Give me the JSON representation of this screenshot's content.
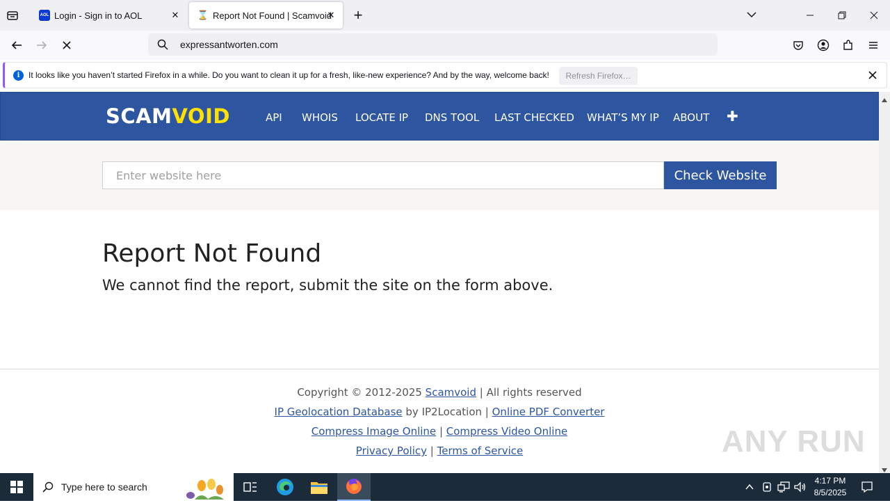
{
  "browser": {
    "tabs": [
      {
        "title": "Login - Sign in to AOL",
        "favicon": "aol-icon",
        "favicon_text": "AOL",
        "active": false
      },
      {
        "title": "Report Not Found | Scamvoid",
        "favicon": "hourglass-icon",
        "active": true
      }
    ],
    "url": "expressantworten.com",
    "notification": {
      "text": "It looks like you haven’t started Firefox in a while. Do you want to clean it up for a fresh, like-new experience? And by the way, welcome back!",
      "button": "Refresh Firefox…"
    }
  },
  "site": {
    "logo_part1": "SCAM",
    "logo_part2": "VOID",
    "nav": [
      "API",
      "WHOIS",
      "LOCATE IP",
      "DNS TOOL",
      "LAST CHECKED",
      "WHAT’S MY IP",
      "ABOUT"
    ],
    "search_placeholder": "Enter website here",
    "check_button": "Check Website",
    "title": "Report Not Found",
    "subtitle": "We cannot find the report, submit the site on the form above.",
    "footer": {
      "copyright": "Copyright © 2012-2025 ",
      "scamvoid_link": "Scamvoid",
      "rights": " | All rights reserved",
      "geo_link": "IP Geolocation Database",
      "by": " by IP2Location | ",
      "pdf_link": "Online PDF Converter",
      "compress_image": "Compress Image Online",
      "sep": " | ",
      "compress_video": "Compress Video Online",
      "privacy": "Privacy Policy",
      "terms": "Terms of Service"
    },
    "watermark": "ANY RUN"
  },
  "taskbar": {
    "search_placeholder": "Type here to search",
    "time": "4:17 PM",
    "date": "8/5/2025"
  },
  "colors": {
    "brand_blue": "#2d55a0",
    "logo_yellow": "#ffe000",
    "notification_accent": "#9059ff"
  }
}
